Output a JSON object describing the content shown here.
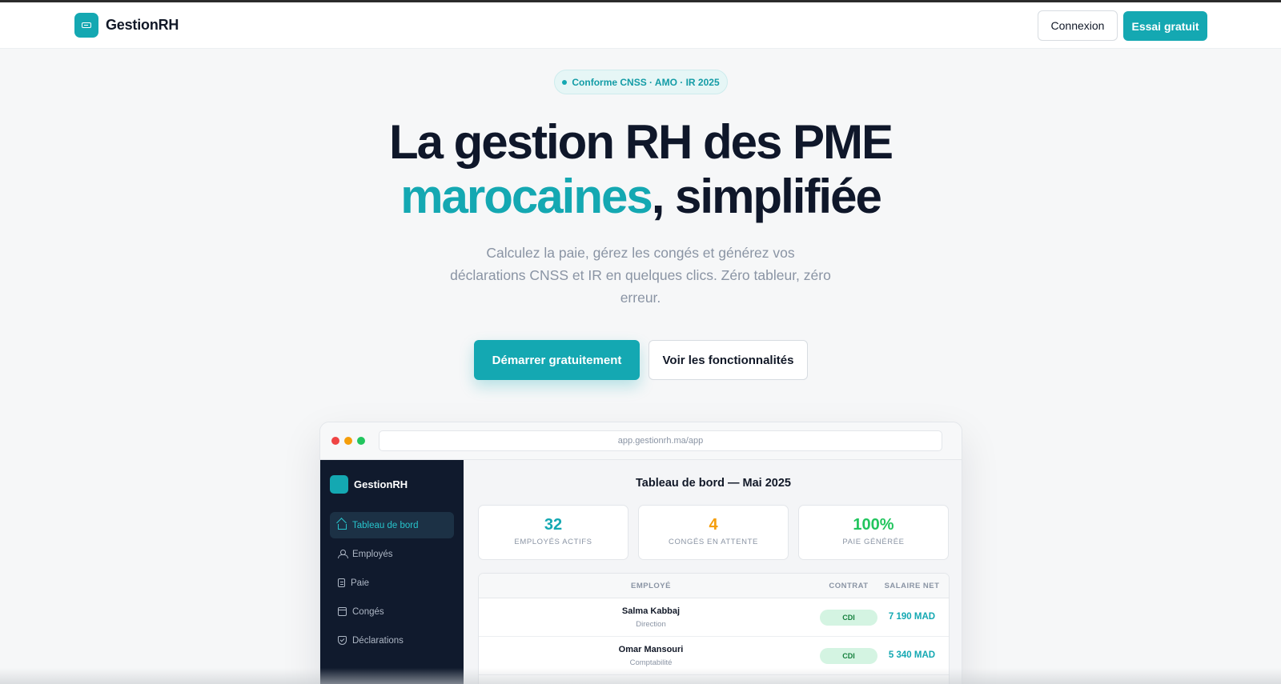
{
  "nav": {
    "brand": "GestionRH",
    "login_label": "Connexion",
    "trial_label": "Essai gratuit"
  },
  "hero": {
    "badge": "Conforme CNSS · AMO · IR 2025",
    "title_line1": "La gestion RH des PME",
    "title_accent": "marocaines",
    "title_rest": ", simplifiée",
    "subtitle": "Calculez la paie, gérez les congés et générez vos déclarations CNSS et IR en quelques clics. Zéro tableur, zéro erreur.",
    "primary_cta": "Démarrer gratuitement",
    "secondary_cta": "Voir les fonctionnalités"
  },
  "preview": {
    "url": "app.gestionrh.ma/app",
    "sidebar": {
      "brand": "GestionRH",
      "items": [
        {
          "label": "Tableau de bord",
          "icon": "home-icon",
          "active": true
        },
        {
          "label": "Employés",
          "icon": "users-icon",
          "active": false
        },
        {
          "label": "Paie",
          "icon": "document-icon",
          "active": false
        },
        {
          "label": "Congés",
          "icon": "calendar-icon",
          "active": false
        },
        {
          "label": "Déclarations",
          "icon": "shield-icon",
          "active": false
        }
      ]
    },
    "dashboard": {
      "title": "Tableau de bord — Mai 2025",
      "stats": [
        {
          "value": "32",
          "label": "EMPLOYÉS ACTIFS",
          "color": "#14a8b2"
        },
        {
          "value": "4",
          "label": "CONGÉS EN ATTENTE",
          "color": "#f59e0b"
        },
        {
          "value": "100%",
          "label": "PAIE GÉNÉRÉE",
          "color": "#22c55e"
        }
      ],
      "table": {
        "headers": {
          "employee": "EMPLOYÉ",
          "contract": "CONTRAT",
          "salary": "SALAIRE NET"
        },
        "rows": [
          {
            "name": "Salma Kabbaj",
            "department": "Direction",
            "contract": "CDI",
            "salary": "7 190 MAD"
          },
          {
            "name": "Omar Mansouri",
            "department": "Comptabilité",
            "contract": "CDI",
            "salary": "5 340 MAD"
          }
        ]
      }
    }
  },
  "colors": {
    "accent": "#14a8b2",
    "sidebar_bg": "#101a2d",
    "heading": "#0f172a"
  }
}
